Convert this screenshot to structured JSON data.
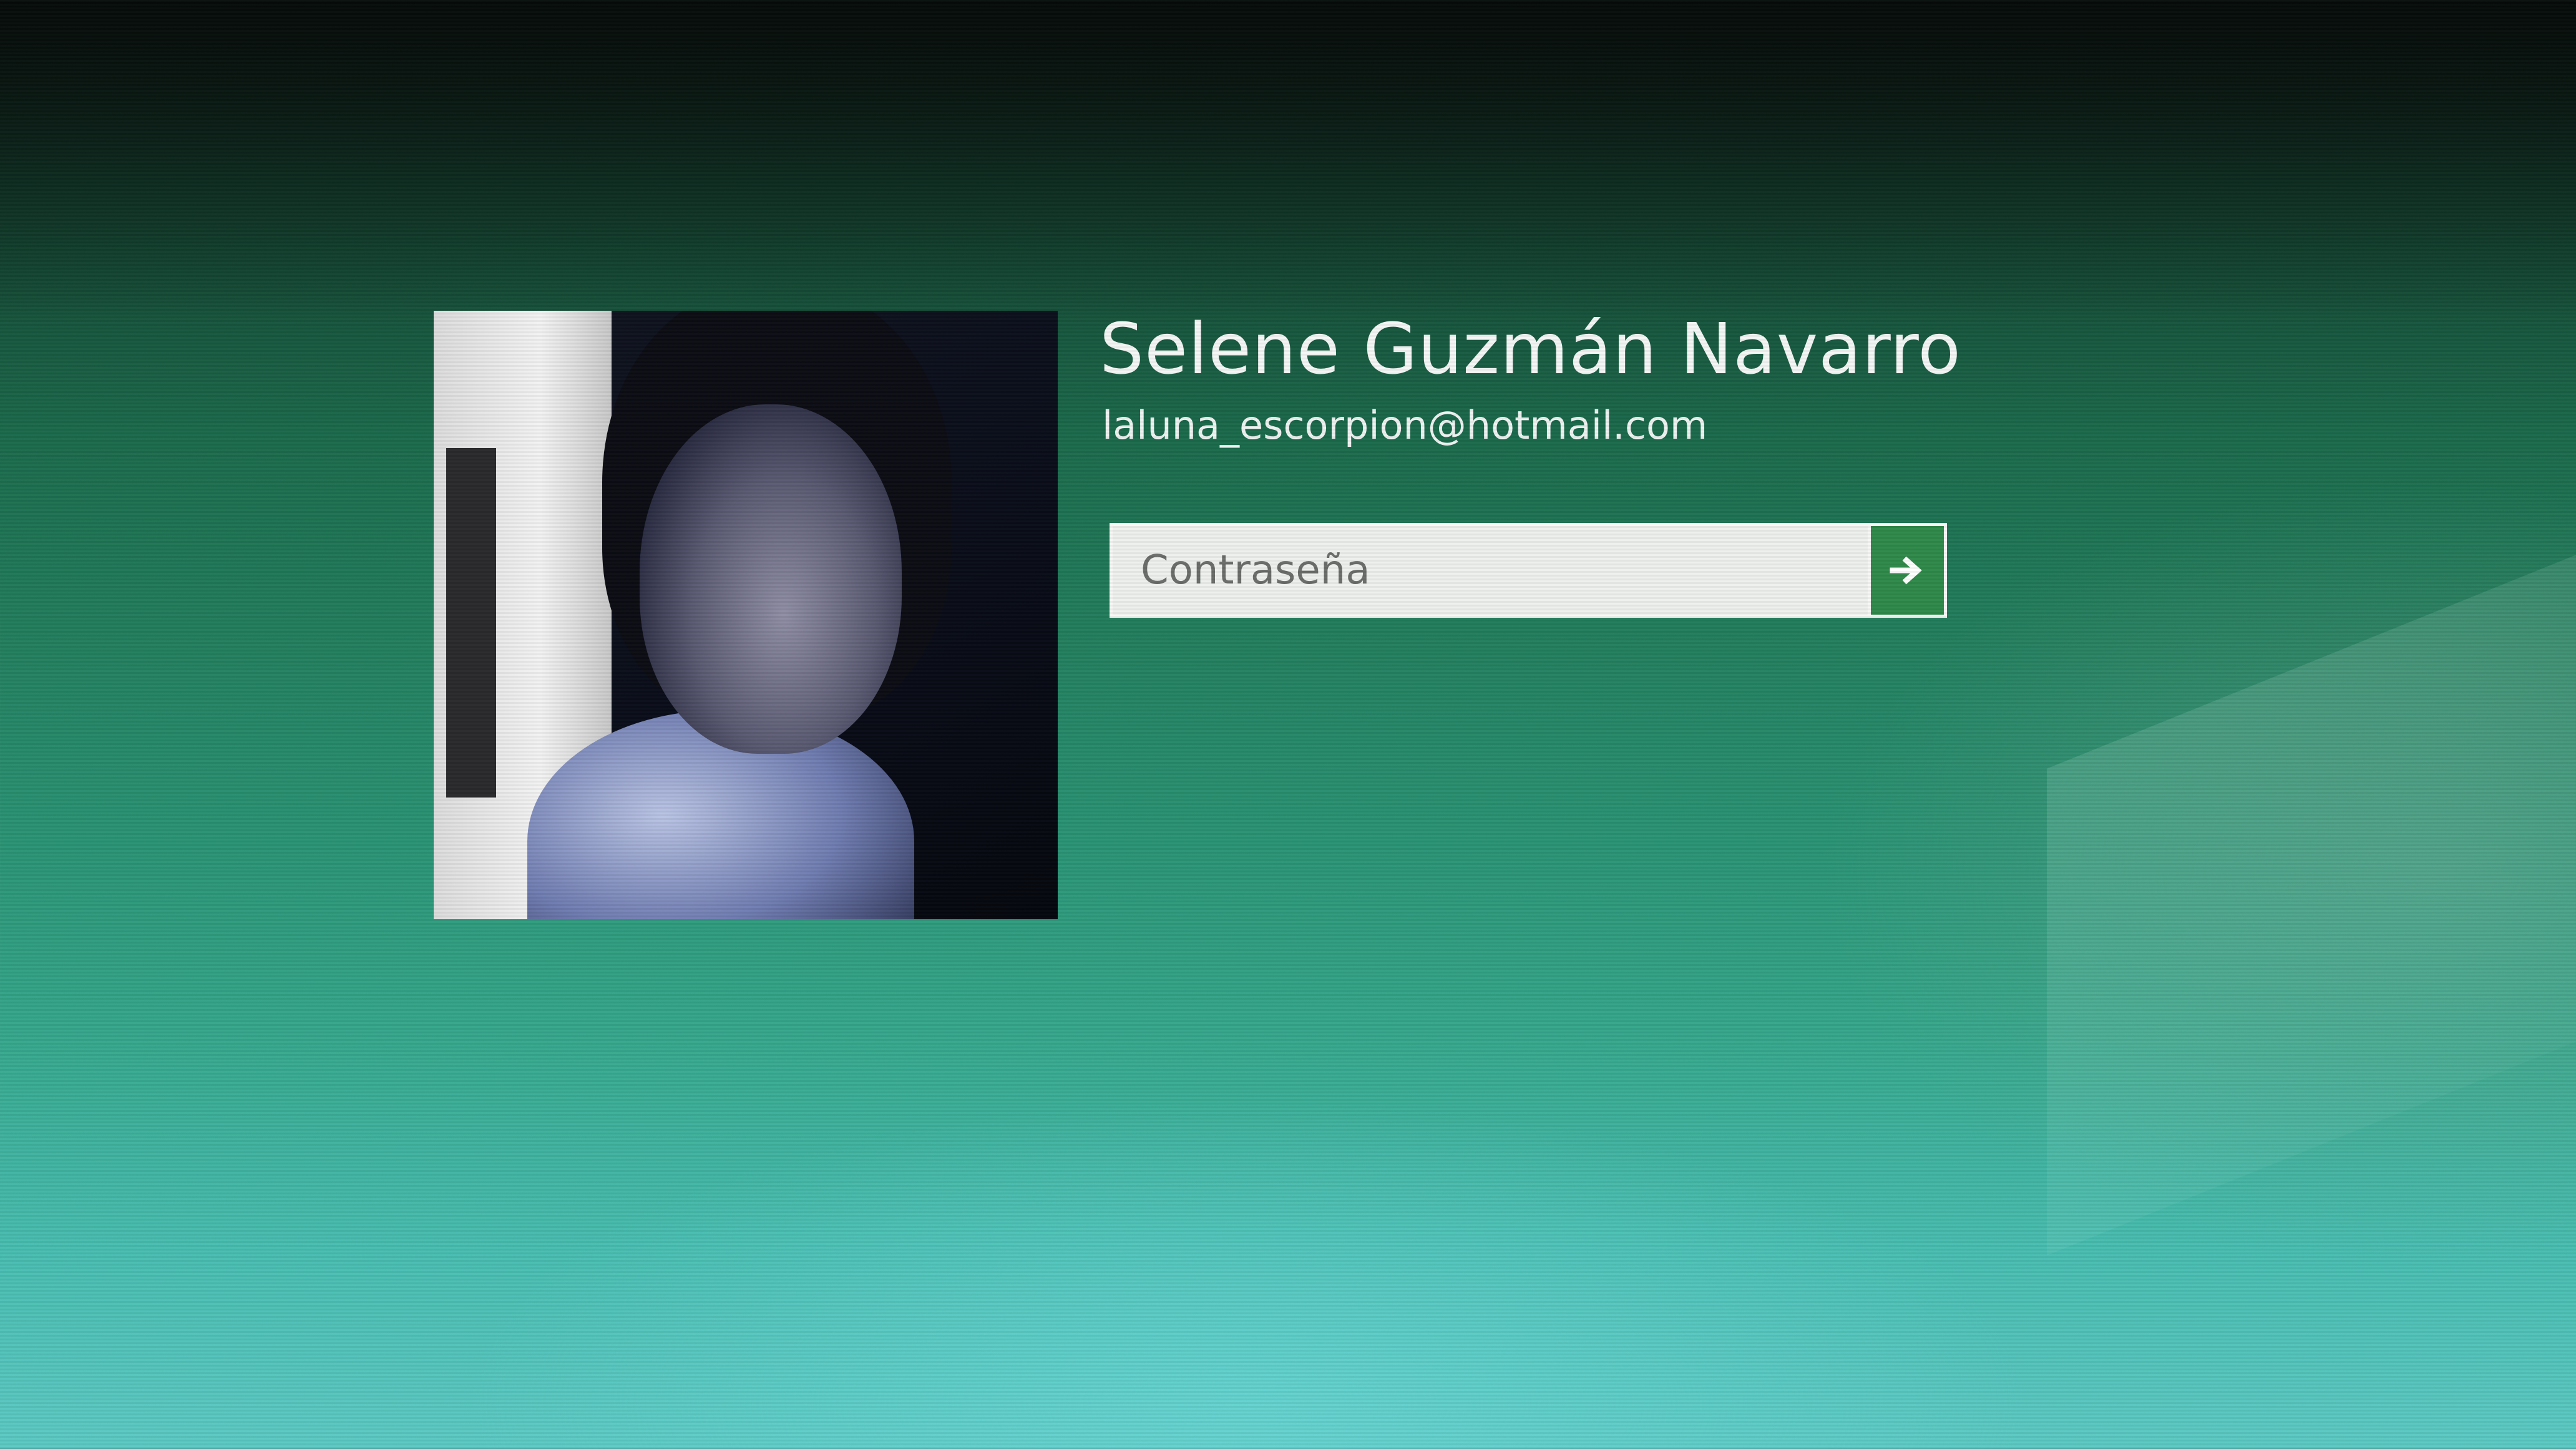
{
  "user": {
    "name": "Selene Guzmán Navarro",
    "email": "laluna_escorpion@hotmail.com"
  },
  "password": {
    "placeholder": "Contraseña",
    "value": ""
  },
  "submit": {
    "icon": "arrow-right-icon"
  },
  "colors": {
    "accent": "#2f8a4a",
    "background": "#23805f",
    "text": "#f3f6f4"
  }
}
